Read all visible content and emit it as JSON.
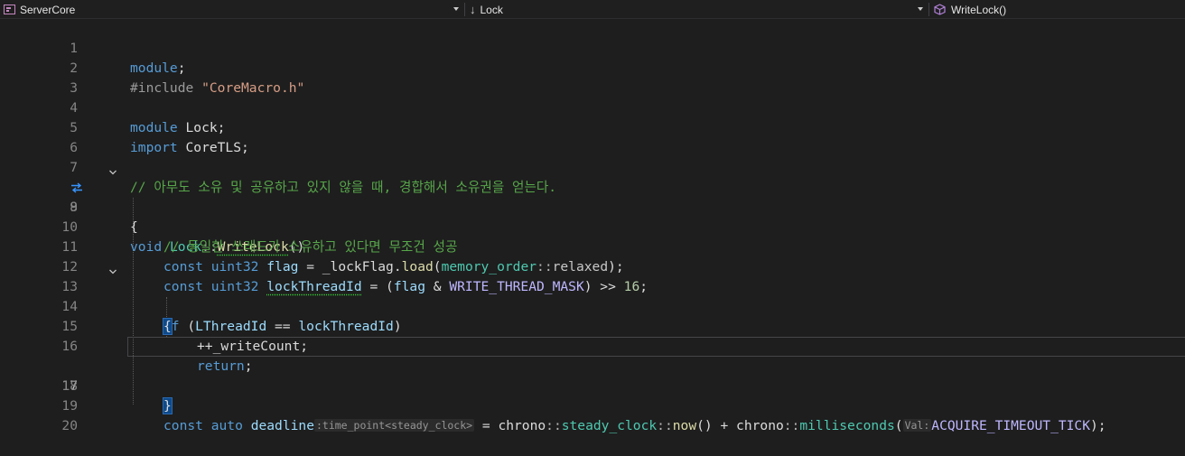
{
  "navbar": {
    "project": "ServerCore",
    "scope": "Lock",
    "member": "WriteLock()"
  },
  "editor": {
    "current_line": "17",
    "line_numbers": [
      "1",
      "2",
      "3",
      "4",
      "5",
      "6",
      "7",
      "8",
      "9",
      "10",
      "11",
      "12",
      "13",
      "14",
      "15",
      "16",
      "17",
      "18",
      "19",
      "20"
    ],
    "colors": {
      "keyword": "#569cd6",
      "type": "#4ec9b0",
      "string": "#d69d85",
      "comment": "#57a64a",
      "function": "#dcdcaa",
      "variable": "#9cdcfe",
      "macro": "#beb7ff",
      "number": "#b5cea8"
    },
    "lines": {
      "l1": {
        "kw": "module",
        "rest": ";"
      },
      "l2": {
        "pp": "#include",
        "sp": " ",
        "str": "\"CoreMacro.h\""
      },
      "l4": {
        "kw": "module",
        "rest": " Lock;"
      },
      "l5": {
        "kw": "import",
        "rest": " CoreTLS;"
      },
      "l7": {
        "comment": "// 아무도 소유 및 공유하고 있지 않을 때, 경합해서 소유권을 얻는다."
      },
      "l8": {
        "kw": "void",
        "cls": " Lock",
        "sep": "::",
        "fn": "WriteLock",
        "rest": "()"
      },
      "l9": {
        "text": "{"
      },
      "l10": {
        "comment": "// 동일한 쓰레드가 소유하고 있다면 무조건 성공"
      },
      "l11": {
        "kw": "const",
        "ty": "uint32",
        "var": "flag",
        "eq": " = ",
        "mem": "_lockFlag",
        "dot": ".",
        "fn": "load",
        "p1": "(",
        "ty2": "memory_order",
        "sep": "::",
        "mem2": "relaxed",
        "p2": ");"
      },
      "l12": {
        "kw": "const",
        "ty": "uint32",
        "var": "lockThreadId",
        "eq": " = (",
        "var2": "flag",
        "amp": " & ",
        "macro": "WRITE_THREAD_MASK",
        "shift": ") >> ",
        "num": "16",
        "end": ";"
      },
      "l13": {
        "kw": "if",
        "p1": " (",
        "var": "LThreadId",
        "eq": " == ",
        "var2": "lockThreadId",
        "p2": ")"
      },
      "l14": {
        "text": "{"
      },
      "l15": {
        "op": "++",
        "mem": "_writeCount",
        "end": ";"
      },
      "l16": {
        "kw": "return",
        "end": ";"
      },
      "l17": {
        "text": "}"
      },
      "l19": {
        "kw": "const",
        "kw2": "auto",
        "var": "deadline",
        "hint": ":time_point<steady_clock>",
        "eq": " = ",
        "ns": "chrono",
        "sep": "::",
        "ty": "steady_clock",
        "sep2": "::",
        "fn": "now",
        "call": "()",
        "plus": " + ",
        "ns2": "chrono",
        "sep3": "::",
        "ty2": "milliseconds",
        "p1": "(",
        "hint2": "Val:",
        "macro": "ACQUIRE_TIMEOUT_TICK",
        "end": ");"
      }
    }
  }
}
